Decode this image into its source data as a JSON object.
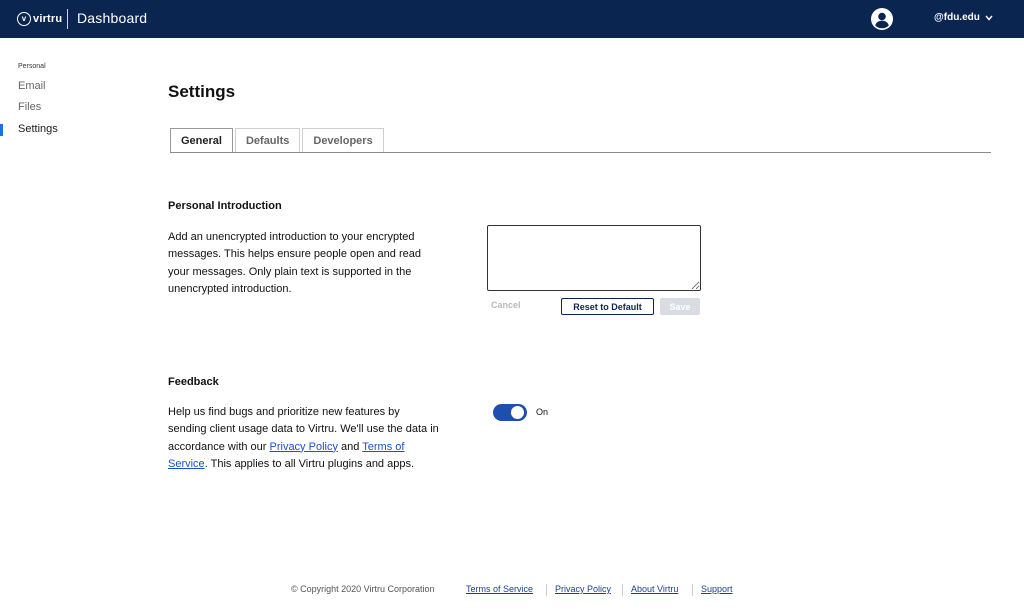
{
  "header": {
    "logo_text": "virtru",
    "logo_mark": "v",
    "title": "Dashboard",
    "account_label": "@fdu.edu",
    "icons": [
      "virtru-logo-icon",
      "user-avatar-icon",
      "chevron-down-icon"
    ]
  },
  "sidebar": {
    "section_label": "Personal",
    "items": [
      {
        "label": "Email",
        "active": false
      },
      {
        "label": "Files",
        "active": false
      },
      {
        "label": "Settings",
        "active": true
      }
    ]
  },
  "main": {
    "title": "Settings",
    "tabs": [
      {
        "label": "General",
        "active": true
      },
      {
        "label": "Defaults",
        "active": false
      },
      {
        "label": "Developers",
        "active": false
      }
    ],
    "intro": {
      "heading": "Personal Introduction",
      "lines": [
        "Add an unencrypted introduction to your encrypted",
        "messages. This helps ensure people open and read",
        "your messages. Only plain text is supported in the",
        "unencrypted introduction."
      ],
      "textarea_value": "",
      "cancel_label": "Cancel",
      "reset_label": "Reset to Default",
      "save_label": "Save"
    },
    "feedback": {
      "heading": "Feedback",
      "line1": "Help us find bugs and prioritize new features by",
      "line2": "sending client usage data to Virtru. We'll use the data in",
      "line3_prefix": "accordance with our ",
      "privacy_link": "Privacy Policy",
      "line3_middle": " and ",
      "terms_link_part1": "Terms of",
      "terms_link_part2": "Service",
      "line4_suffix": ". This applies to all Virtru plugins and apps.",
      "toggle_state": "On",
      "toggle_on": true
    }
  },
  "footer": {
    "copyright": "© Copyright 2020 Virtru Corporation",
    "links": [
      "Terms of Service",
      "Privacy Policy",
      "About Virtru",
      "Support"
    ]
  },
  "colors": {
    "header_bg": "#0b2551",
    "accent": "#1f4fae",
    "link": "#1b52c4",
    "active_indicator": "#1f6feb"
  }
}
